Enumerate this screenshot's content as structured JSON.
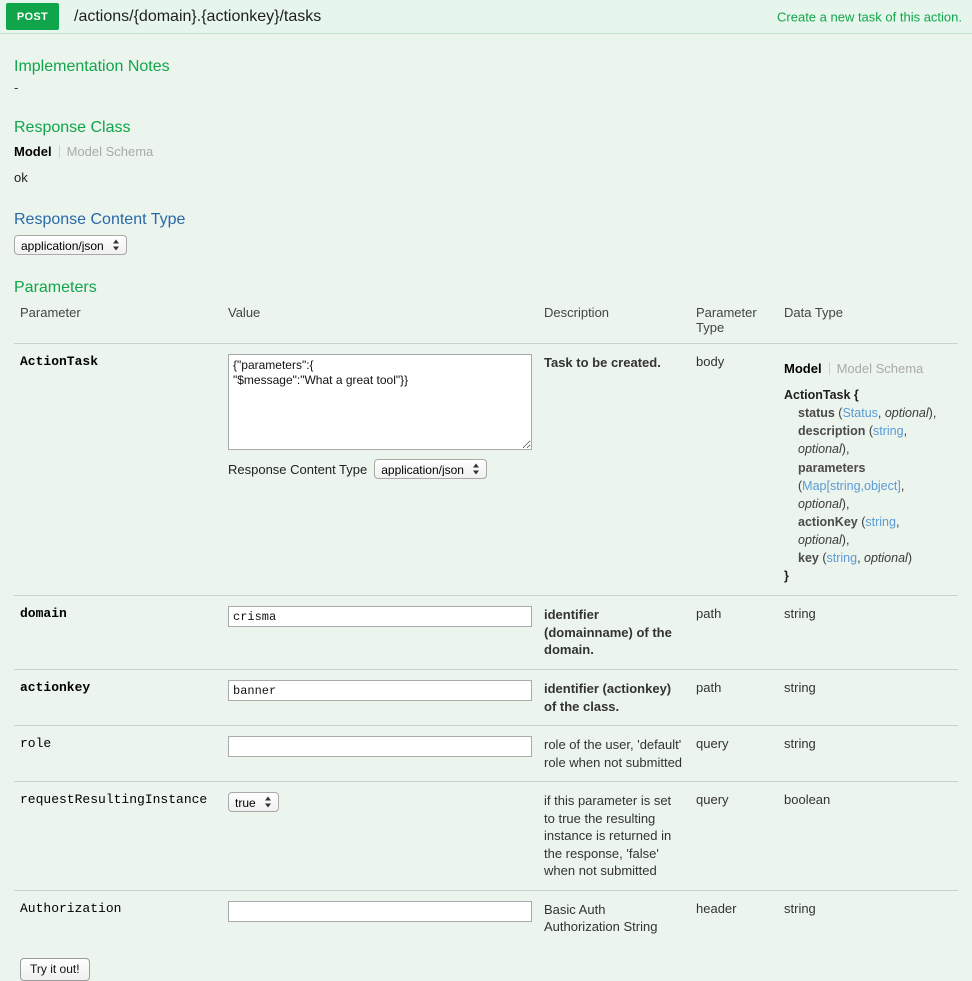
{
  "operation": {
    "method": "POST",
    "path": "/actions/{domain}.{actionkey}/tasks",
    "summary": "Create a new task of this action."
  },
  "implementation_notes": {
    "heading": "Implementation Notes",
    "text": "-"
  },
  "response_class": {
    "heading": "Response Class",
    "tab_model": "Model",
    "tab_model_schema": "Model Schema",
    "signature": "ok"
  },
  "response_content_type": {
    "heading": "Response Content Type",
    "selected": "application/json",
    "options": [
      "application/json"
    ]
  },
  "parameters_section": {
    "heading": "Parameters",
    "columns": {
      "parameter": "Parameter",
      "value": "Value",
      "description": "Description",
      "parameter_type": "Parameter Type",
      "data_type": "Data Type"
    }
  },
  "rows": [
    {
      "name": "ActionTask",
      "value": "{\"parameters\":{\n\"$message\":\"What a great tool\"}}",
      "description": "Task to be created.",
      "parameter_type": "body",
      "data_type": "model",
      "body_content_type": {
        "label": "Response Content Type",
        "selected": "application/json",
        "options": [
          "application/json"
        ]
      },
      "model": {
        "tab_model": "Model",
        "tab_model_schema": "Model Schema",
        "class_open": "ActionTask {",
        "class_close": "}",
        "properties": [
          {
            "name": "status",
            "type": "Status",
            "modifier": "optional",
            "trailing": ","
          },
          {
            "name": "description",
            "type": "string",
            "modifier": "optional",
            "trailing": ","
          },
          {
            "name": "parameters",
            "type": "Map[string,object]",
            "modifier": "optional",
            "trailing": ","
          },
          {
            "name": "actionKey",
            "type": "string",
            "modifier": "optional",
            "trailing": ","
          },
          {
            "name": "key",
            "type": "string",
            "modifier": "optional",
            "trailing": ""
          }
        ]
      }
    },
    {
      "name": "domain",
      "value": "crisma",
      "description": "identifier (domainname) of the domain.",
      "parameter_type": "path",
      "data_type": "string",
      "control": "text"
    },
    {
      "name": "actionkey",
      "value": "banner",
      "description": "identifier (actionkey) of the class.",
      "parameter_type": "path",
      "data_type": "string",
      "control": "text"
    },
    {
      "name": "role",
      "value": "",
      "description": "role of the user, 'default' role when not submitted",
      "parameter_type": "query",
      "data_type": "string",
      "control": "text"
    },
    {
      "name": "requestResultingInstance",
      "value": "true",
      "description": "if this parameter is set to true the resulting instance is returned in the response, 'false' when not submitted",
      "parameter_type": "query",
      "data_type": "boolean",
      "control": "select",
      "options": [
        "true",
        "false"
      ]
    },
    {
      "name": "Authorization",
      "value": "",
      "description": "Basic Auth Authorization String",
      "parameter_type": "header",
      "data_type": "string",
      "control": "text"
    }
  ],
  "actions": {
    "try_it_out": "Try it out!"
  },
  "colors": {
    "method_badge": "#10a54a",
    "heading_green": "#10a54a",
    "heading_blue": "#2a69a7",
    "background": "#ecf4ee",
    "header_background": "#e7f6ec",
    "type_link": "#5b9ad4"
  }
}
